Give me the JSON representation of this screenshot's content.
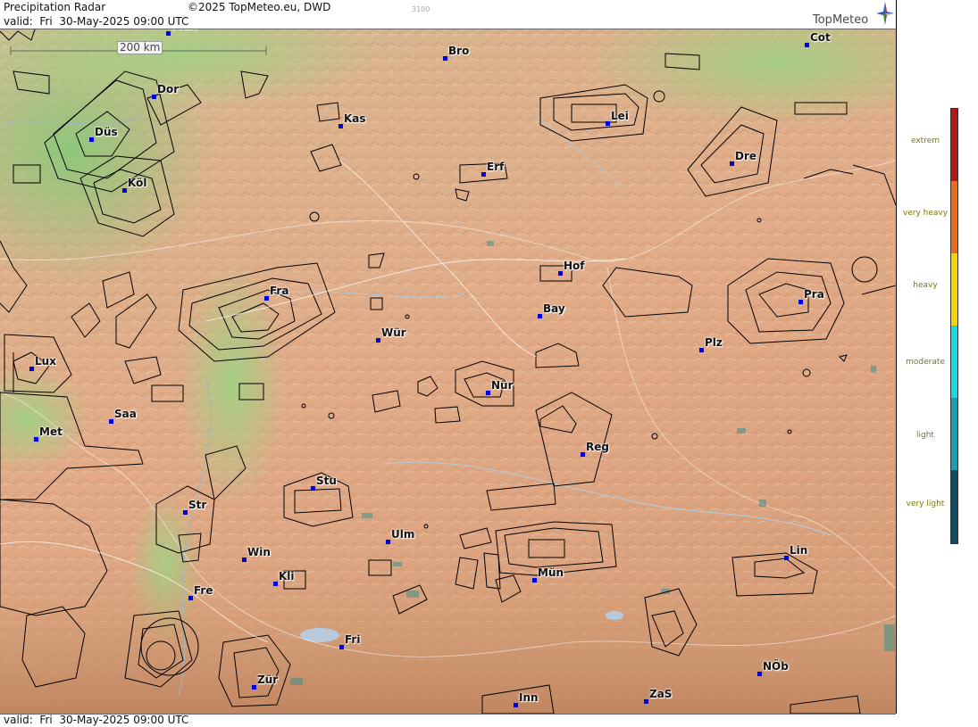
{
  "header": {
    "title": "Precipitation Radar",
    "copyright": "©2025 TopMeteo.eu, DWD",
    "code": "3100",
    "valid_line": "valid:  Fri  30-May-2025 09:00 UTC"
  },
  "footer": {
    "valid_line": "valid:  Fri  30-May-2025 09:00 UTC"
  },
  "logo": {
    "text": "TopMeteo"
  },
  "scale": {
    "label": "200 km"
  },
  "colors": {
    "city_marker": "#0000dd",
    "extrem": "#b01a12",
    "very_heavy": "#ee6a1a",
    "heavy": "#f5d20a",
    "moderate": "#1ad8e0",
    "light": "#16a0b0",
    "very_light": "#0f4a66"
  },
  "legend": {
    "items": [
      {
        "label": "extrem",
        "color": "#b01a12"
      },
      {
        "label": "very heavy",
        "color": "#ee6a1a"
      },
      {
        "label": "heavy",
        "color": "#f5d20a"
      },
      {
        "label": "moderate",
        "color": "#1ad8e0"
      },
      {
        "label": "light",
        "color": "#16a0b0"
      },
      {
        "label": "very light",
        "color": "#0f4a66"
      }
    ]
  },
  "cities": [
    {
      "label": "Mün"
    },
    {
      "label": "Cot"
    },
    {
      "label": "Bro"
    },
    {
      "label": "Dor"
    },
    {
      "label": "Kas"
    },
    {
      "label": "Lei"
    },
    {
      "label": "Düs"
    },
    {
      "label": "Dre"
    },
    {
      "label": "Erf"
    },
    {
      "label": "Köl"
    },
    {
      "label": "Hof"
    },
    {
      "label": "Fra"
    },
    {
      "label": "Pra"
    },
    {
      "label": "Bay"
    },
    {
      "label": "Wür"
    },
    {
      "label": "Plz"
    },
    {
      "label": "Lux"
    },
    {
      "label": "Nür"
    },
    {
      "label": "Saa"
    },
    {
      "label": "Met"
    },
    {
      "label": "Reg"
    },
    {
      "label": "Stu"
    },
    {
      "label": "Str"
    },
    {
      "label": "Ulm"
    },
    {
      "label": "Win"
    },
    {
      "label": "Lin"
    },
    {
      "label": "Kli"
    },
    {
      "label": "Mün"
    },
    {
      "label": "Fre"
    },
    {
      "label": "Fri"
    },
    {
      "label": "NÖb"
    },
    {
      "label": "Zür"
    },
    {
      "label": "ZaS"
    },
    {
      "label": "Inn"
    }
  ]
}
